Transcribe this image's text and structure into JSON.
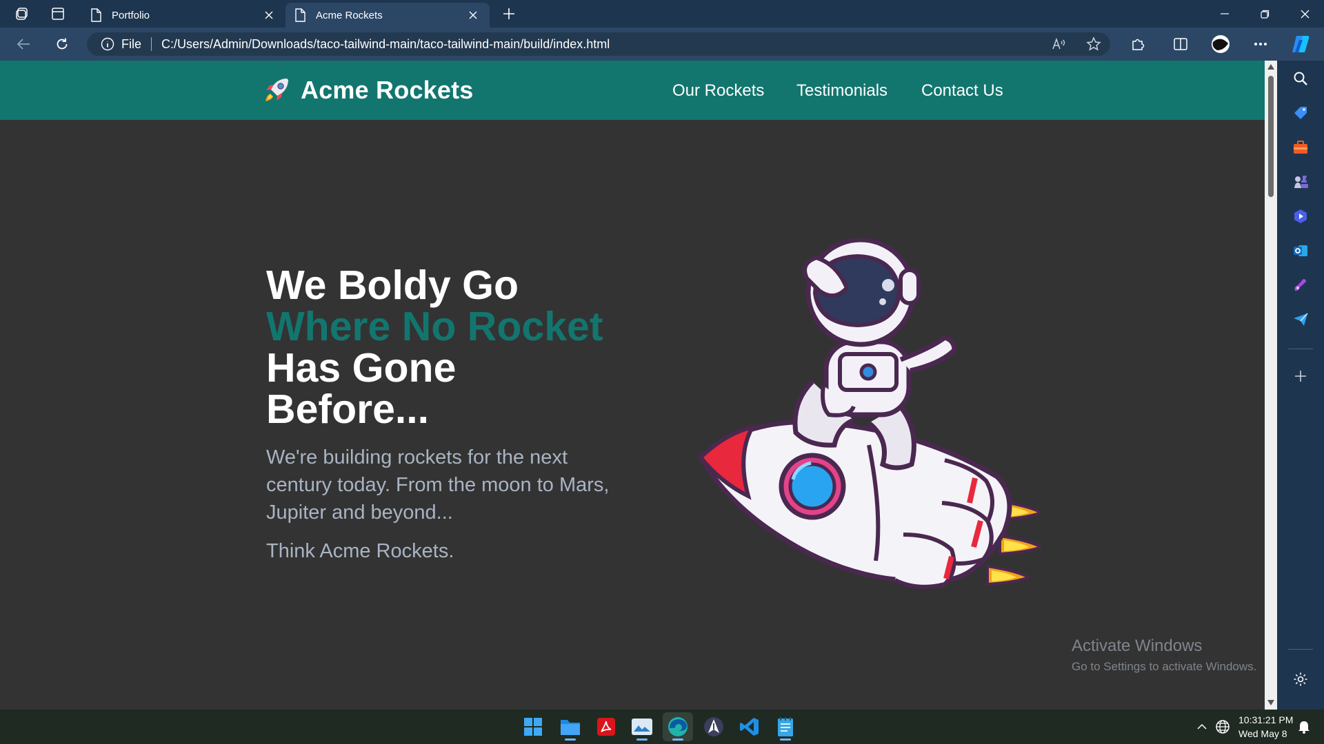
{
  "browser": {
    "tabs": [
      {
        "title": "Portfolio",
        "active": false
      },
      {
        "title": "Acme Rockets",
        "active": true
      }
    ],
    "address": {
      "scheme_label": "File",
      "url": "C:/Users/Admin/Downloads/taco-tailwind-main/taco-tailwind-main/build/index.html"
    },
    "theme_color": "#2c4766"
  },
  "site": {
    "brand": {
      "name": "Acme Rockets",
      "logo_icon": "rocket-icon"
    },
    "nav": [
      "Our Rockets",
      "Testimonials",
      "Contact Us"
    ],
    "header_color": "#12766f",
    "hero": {
      "title_line1": "We Boldy Go",
      "title_accent": "Where No Rocket",
      "title_line3": "Has Gone",
      "title_line4": "Before...",
      "body": "We're building rockets for the next century today. From the moon to Mars, Jupiter and beyond...",
      "tagline": "Think Acme Rockets.",
      "illustration": "astronaut-on-rocket-illustration"
    }
  },
  "watermark": {
    "title": "Activate Windows",
    "subtitle": "Go to Settings to activate Windows."
  },
  "sidebar_icons": [
    "search-icon",
    "shopping-tag-icon",
    "toolbox-icon",
    "chess-icon",
    "copilot-play-icon",
    "outlook-icon",
    "designer-icon",
    "send-icon",
    "add-icon",
    "settings-icon"
  ],
  "taskbar": {
    "apps": [
      "windows-start",
      "file-explorer",
      "acrobat-reader",
      "photos",
      "microsoft-edge",
      "rocket-app",
      "vs-code",
      "notepad"
    ],
    "time": "10:31:21 PM",
    "date": "Wed May 8"
  }
}
